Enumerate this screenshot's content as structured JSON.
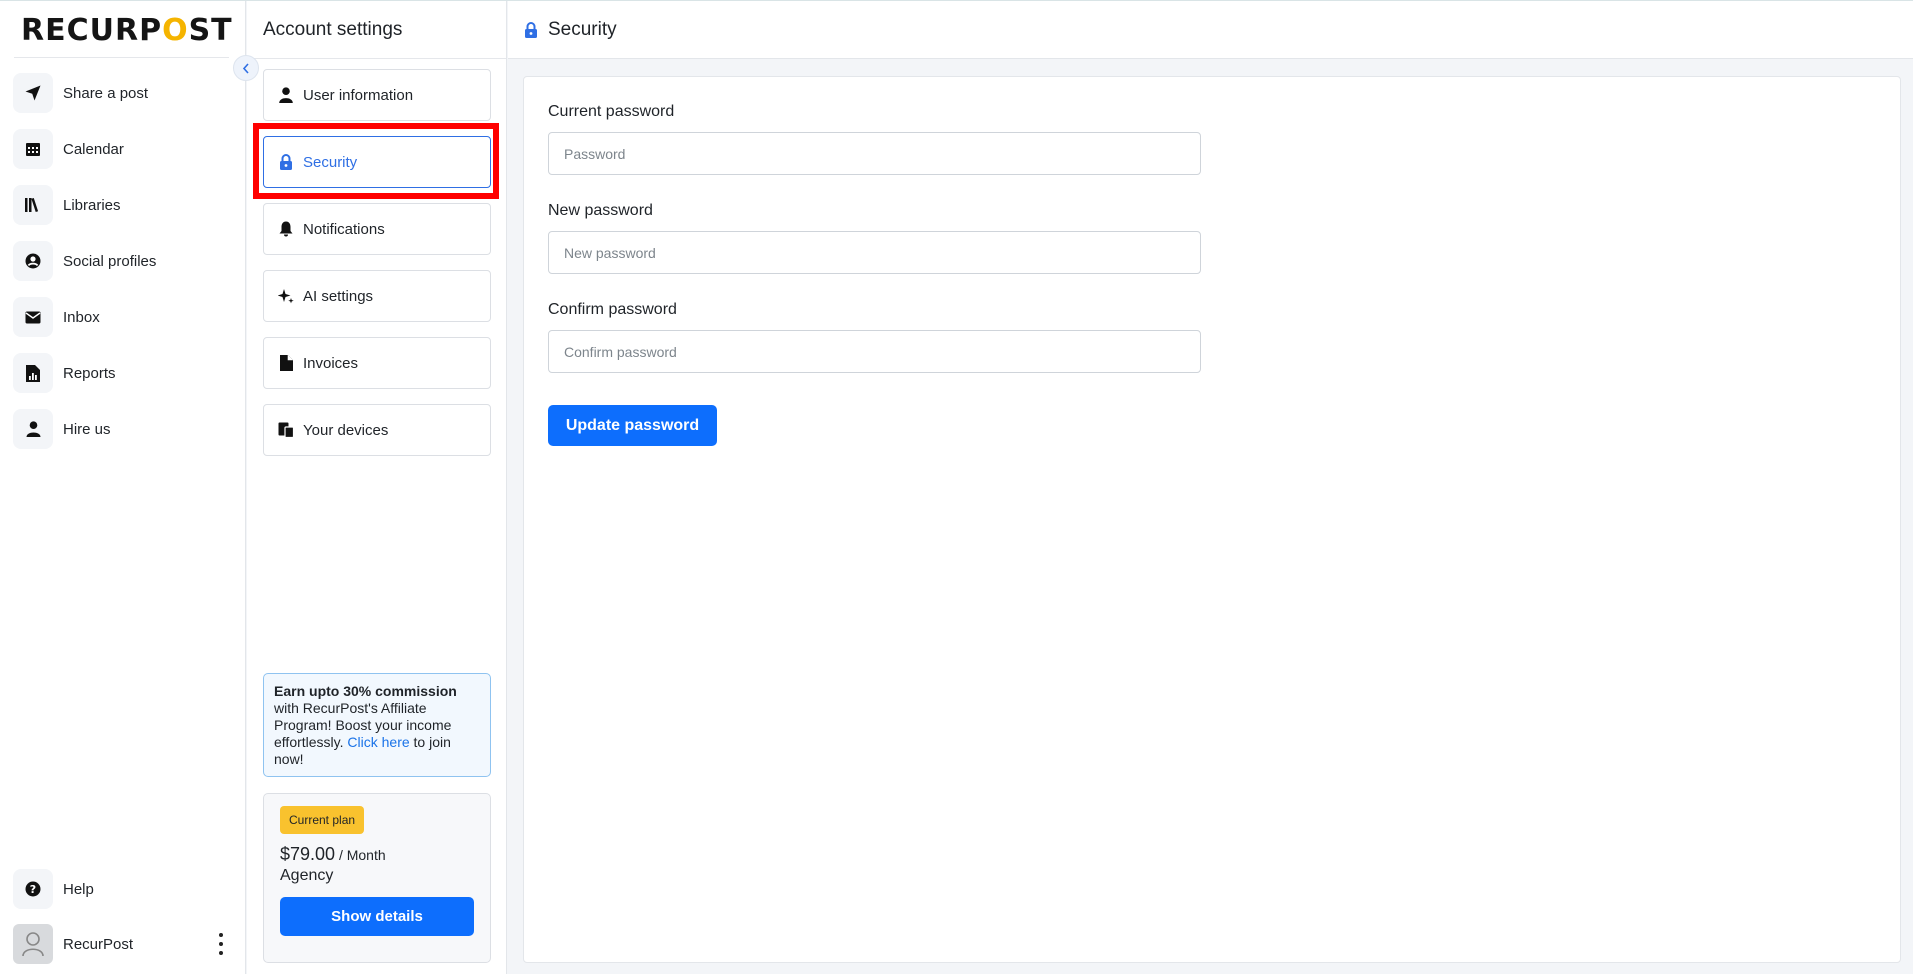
{
  "brand": {
    "logo_pre": "RECURP",
    "logo_o": "O",
    "logo_post": "ST"
  },
  "sidebar": {
    "items": [
      {
        "label": "Share a post",
        "icon": "send-icon"
      },
      {
        "label": "Calendar",
        "icon": "calendar-icon"
      },
      {
        "label": "Libraries",
        "icon": "library-icon"
      },
      {
        "label": "Social profiles",
        "icon": "user-circle-icon"
      },
      {
        "label": "Inbox",
        "icon": "envelope-icon"
      },
      {
        "label": "Reports",
        "icon": "report-icon"
      },
      {
        "label": "Hire us",
        "icon": "person-icon"
      }
    ],
    "help_label": "Help",
    "profile_name": "RecurPost"
  },
  "settings": {
    "title": "Account settings",
    "menu": [
      {
        "label": "User information",
        "icon": "person-icon",
        "active": false
      },
      {
        "label": "Security",
        "icon": "lock-icon",
        "active": true
      },
      {
        "label": "Notifications",
        "icon": "bell-icon",
        "active": false
      },
      {
        "label": "AI settings",
        "icon": "sparkle-icon",
        "active": false
      },
      {
        "label": "Invoices",
        "icon": "file-icon",
        "active": false
      },
      {
        "label": "Your devices",
        "icon": "devices-icon",
        "active": false
      }
    ],
    "promo": {
      "bold": "Earn upto 30% commission",
      "text1": " with RecurPost's Affiliate Program! Boost your income effortlessly. ",
      "link": "Click here",
      "text2": " to join now!"
    },
    "plan": {
      "badge": "Current plan",
      "price": "$79.00",
      "period": " / Month",
      "name": "Agency",
      "button": "Show details"
    }
  },
  "main": {
    "title": "Security",
    "fields": [
      {
        "label": "Current password",
        "placeholder": "Password"
      },
      {
        "label": "New password",
        "placeholder": "New password"
      },
      {
        "label": "Confirm password",
        "placeholder": "Confirm password"
      }
    ],
    "submit": "Update password"
  },
  "colors": {
    "accent": "#0d6efd",
    "highlight": "#ff0000",
    "plan_badge": "#f9c22e"
  }
}
